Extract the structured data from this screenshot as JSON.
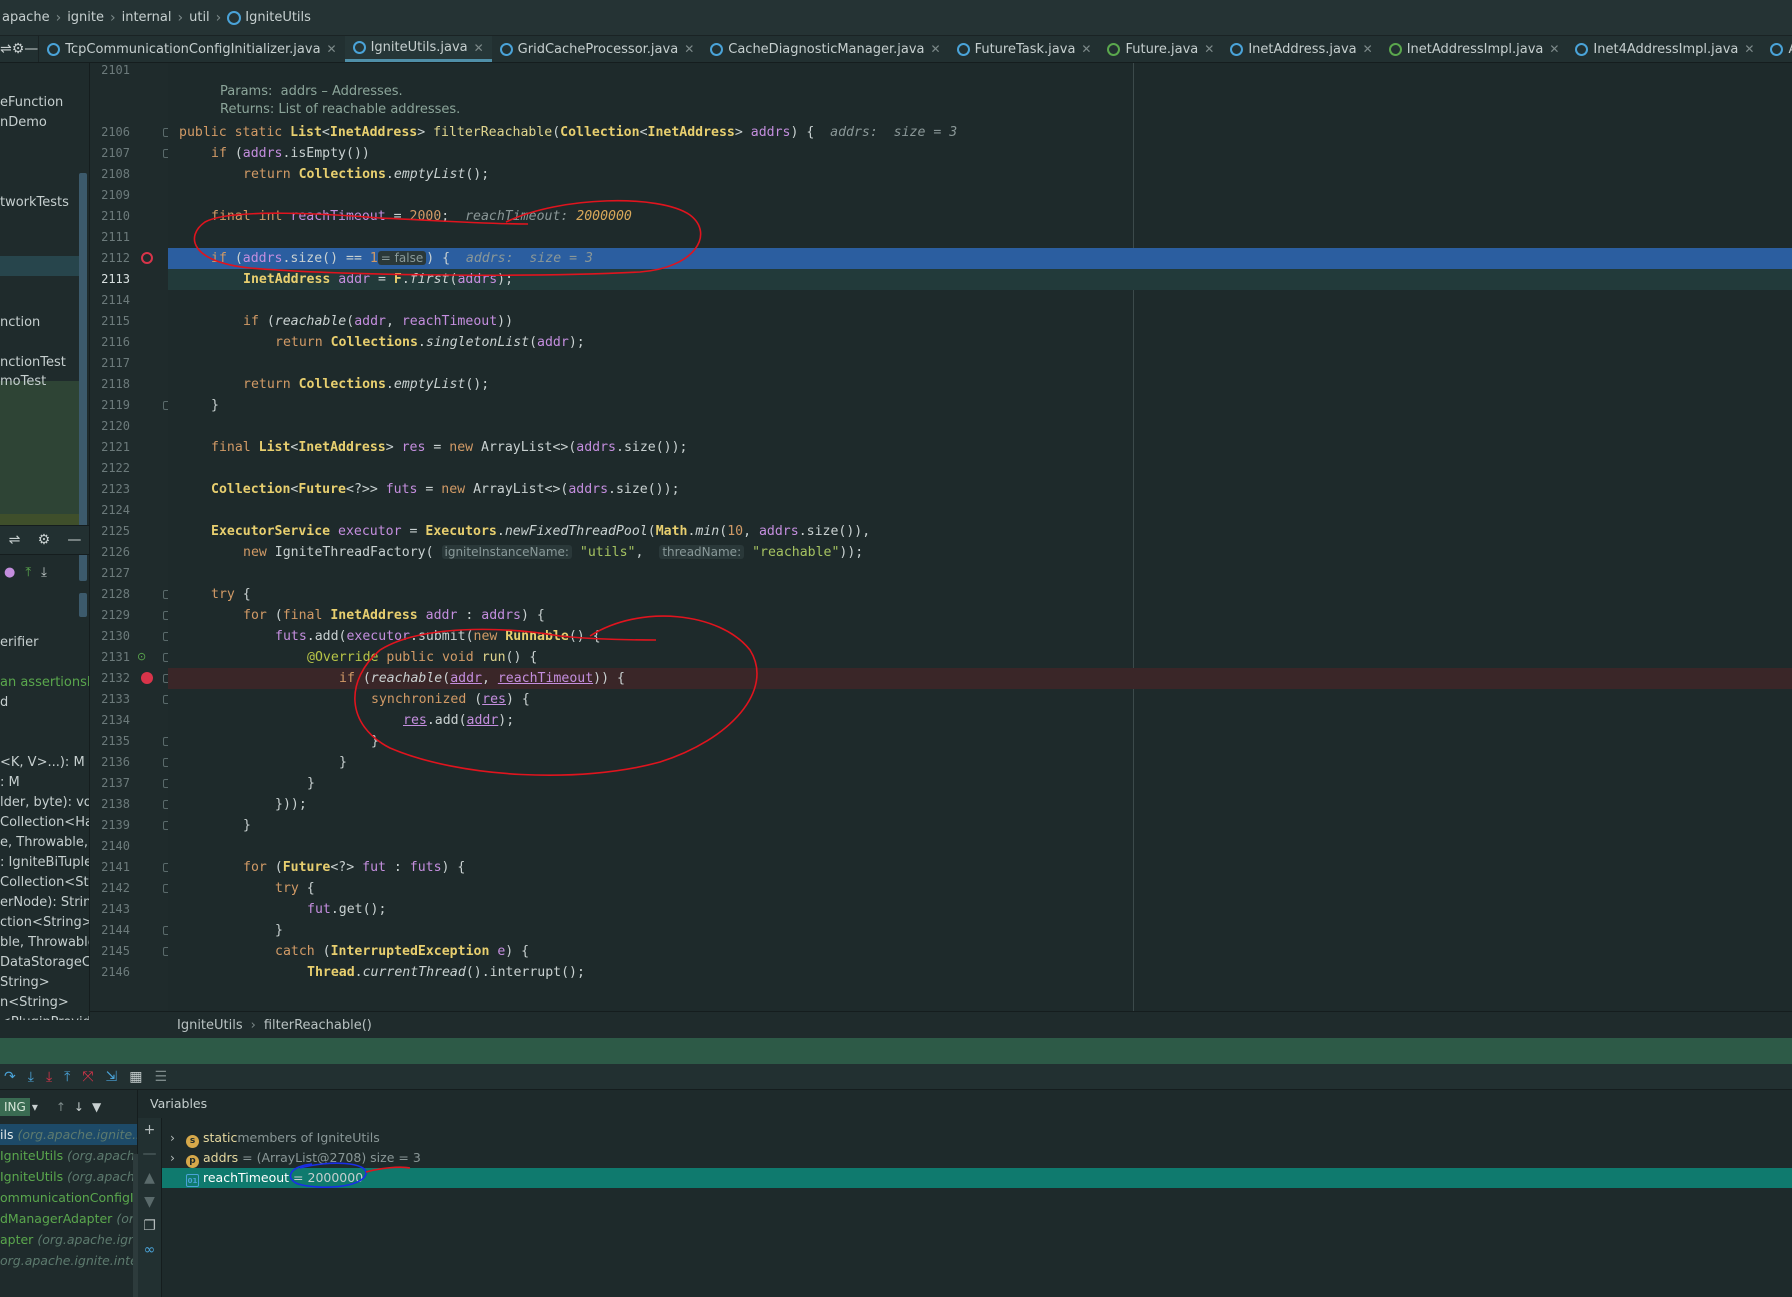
{
  "breadcrumb": [
    "apache",
    "ignite",
    "internal",
    "util",
    "IgniteUtils"
  ],
  "tabs": [
    {
      "label": "TcpCommunicationConfigInitializer.java",
      "color": "#4aa3d8",
      "active": false
    },
    {
      "label": "IgniteUtils.java",
      "color": "#4aa3d8",
      "active": true
    },
    {
      "label": "GridCacheProcessor.java",
      "color": "#4aa3d8",
      "active": false
    },
    {
      "label": "CacheDiagnosticManager.java",
      "color": "#4aa3d8",
      "active": false
    },
    {
      "label": "FutureTask.java",
      "color": "#4aa3d8",
      "active": false
    },
    {
      "label": "Future.java",
      "color": "#5aa74d",
      "active": false
    },
    {
      "label": "InetAddress.java",
      "color": "#4aa3d8",
      "active": false
    },
    {
      "label": "InetAddressImpl.java",
      "color": "#5aa74d",
      "active": false
    },
    {
      "label": "Inet4AddressImpl.java",
      "color": "#4aa3d8",
      "active": false
    },
    {
      "label": "AddressNetwork",
      "color": "#4aa3d8",
      "active": false
    }
  ],
  "project_items": [
    {
      "label": "eFunction",
      "style": ""
    },
    {
      "label": "nDemo",
      "style": ""
    },
    {
      "label": "tworkTests",
      "style": ""
    },
    {
      "label": "nction",
      "style": ""
    },
    {
      "label": "nctionTest",
      "style": ""
    },
    {
      "label": "moTest",
      "style": ""
    }
  ],
  "structure_items": [
    {
      "label": "erifier",
      "style": ""
    },
    {
      "label": "an assertionsEr",
      "style": "green"
    },
    {
      "label": "d",
      "style": ""
    },
    {
      "label": "<K, V>...): M",
      "style": ""
    },
    {
      "label": ": M",
      "style": ""
    },
    {
      "label": "lder, byte): void",
      "style": ""
    },
    {
      "label": "Collection<Han",
      "style": ""
    },
    {
      "label": "e, Throwable, Ig",
      "style": ""
    },
    {
      "label": ": IgniteBiTuple<",
      "style": ""
    },
    {
      "label": "Collection<Strin",
      "style": ""
    },
    {
      "label": "erNode): String",
      "style": ""
    },
    {
      "label": "ction<String>, (",
      "style": ""
    },
    {
      "label": "ble, Throwable)",
      "style": ""
    },
    {
      "label": "DataStorageCo",
      "style": ""
    },
    {
      "label": "String>",
      "style": ""
    },
    {
      "label": "n<String>",
      "style": ""
    },
    {
      "label": "<PluginProvider",
      "style": ""
    }
  ],
  "code": {
    "line_numbers": [
      "2101",
      "",
      "",
      "",
      "",
      "2106",
      "2107",
      "2108",
      "2109",
      "2110",
      "2111",
      "2112",
      "2113",
      "2114",
      "2115",
      "2116",
      "2117",
      "2118",
      "2119",
      "2120",
      "2121",
      "2122",
      "2123",
      "2124",
      "2125",
      "2126",
      "2127",
      "2128",
      "2129",
      "2130",
      "2131",
      "2132",
      "2133",
      "2134",
      "2135",
      "2136",
      "2137",
      "2138",
      "2139",
      "2140",
      "2141",
      "2142",
      "2143",
      "2144",
      "2145",
      "2146"
    ],
    "doc_params": "Params:  addrs – Addresses.",
    "doc_returns": "Returns: List of reachable addresses."
  },
  "editor_breadcrumb": [
    "IgniteUtils",
    "filterReachable()"
  ],
  "frames": {
    "thread": "ING",
    "items": [
      {
        "label": "ils",
        "pkg": "(org.apache.ignite.i",
        "selected": true
      },
      {
        "label": "IgniteUtils",
        "pkg": "(org.apache",
        "selected": false
      },
      {
        "label": "IgniteUtils",
        "pkg": "(org.apache",
        "selected": false
      },
      {
        "label": "ommunicationConfigIn",
        "pkg": "",
        "selected": false
      },
      {
        "label": "dManagerAdapter",
        "pkg": "(org",
        "selected": false
      },
      {
        "label": "apter",
        "pkg": "(org.apache.ignite",
        "selected": false
      },
      {
        "label": "",
        "pkg": "org.apache.ignite.internal.",
        "selected": false
      }
    ]
  },
  "variables": {
    "title": "Variables",
    "rows": [
      {
        "icon": "s",
        "icon_color": "#d6a84a",
        "expand": true,
        "name": "static",
        "rest": "members of IgniteUtils",
        "selected": false
      },
      {
        "icon": "p",
        "icon_color": "#d6a84a",
        "expand": true,
        "name": "addrs",
        "rest": " = (ArrayList@2708)  size = 3",
        "selected": false
      },
      {
        "icon": "01",
        "icon_color": "#4aa3d8",
        "expand": false,
        "name": "reachTimeout",
        "rest": " = 2000000",
        "selected": true
      }
    ]
  }
}
